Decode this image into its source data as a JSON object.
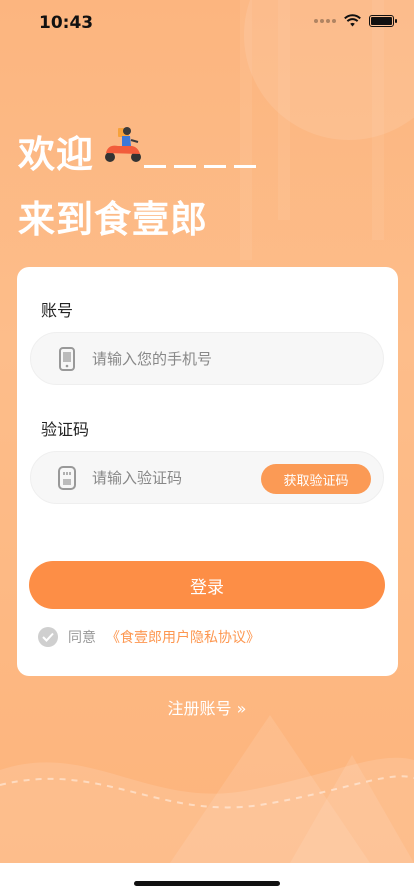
{
  "status_bar": {
    "time": "10:43"
  },
  "welcome": {
    "line1": "欢迎",
    "line2": "来到食壹郎"
  },
  "form": {
    "account_label": "账号",
    "phone_placeholder": "请输入您的手机号",
    "code_label": "验证码",
    "code_placeholder": "请输入验证码",
    "get_code_button": "获取验证码",
    "login_button": "登录",
    "agree_text": "同意",
    "privacy_link": "《食壹郎用户隐私协议》"
  },
  "register_link": "注册账号 »",
  "colors": {
    "brand": "#fd8e46",
    "background": "#fdbd8a",
    "link": "#fd9750"
  },
  "icons": [
    "scooter-rider-icon",
    "phone-icon",
    "sim-card-icon",
    "check-icon"
  ]
}
